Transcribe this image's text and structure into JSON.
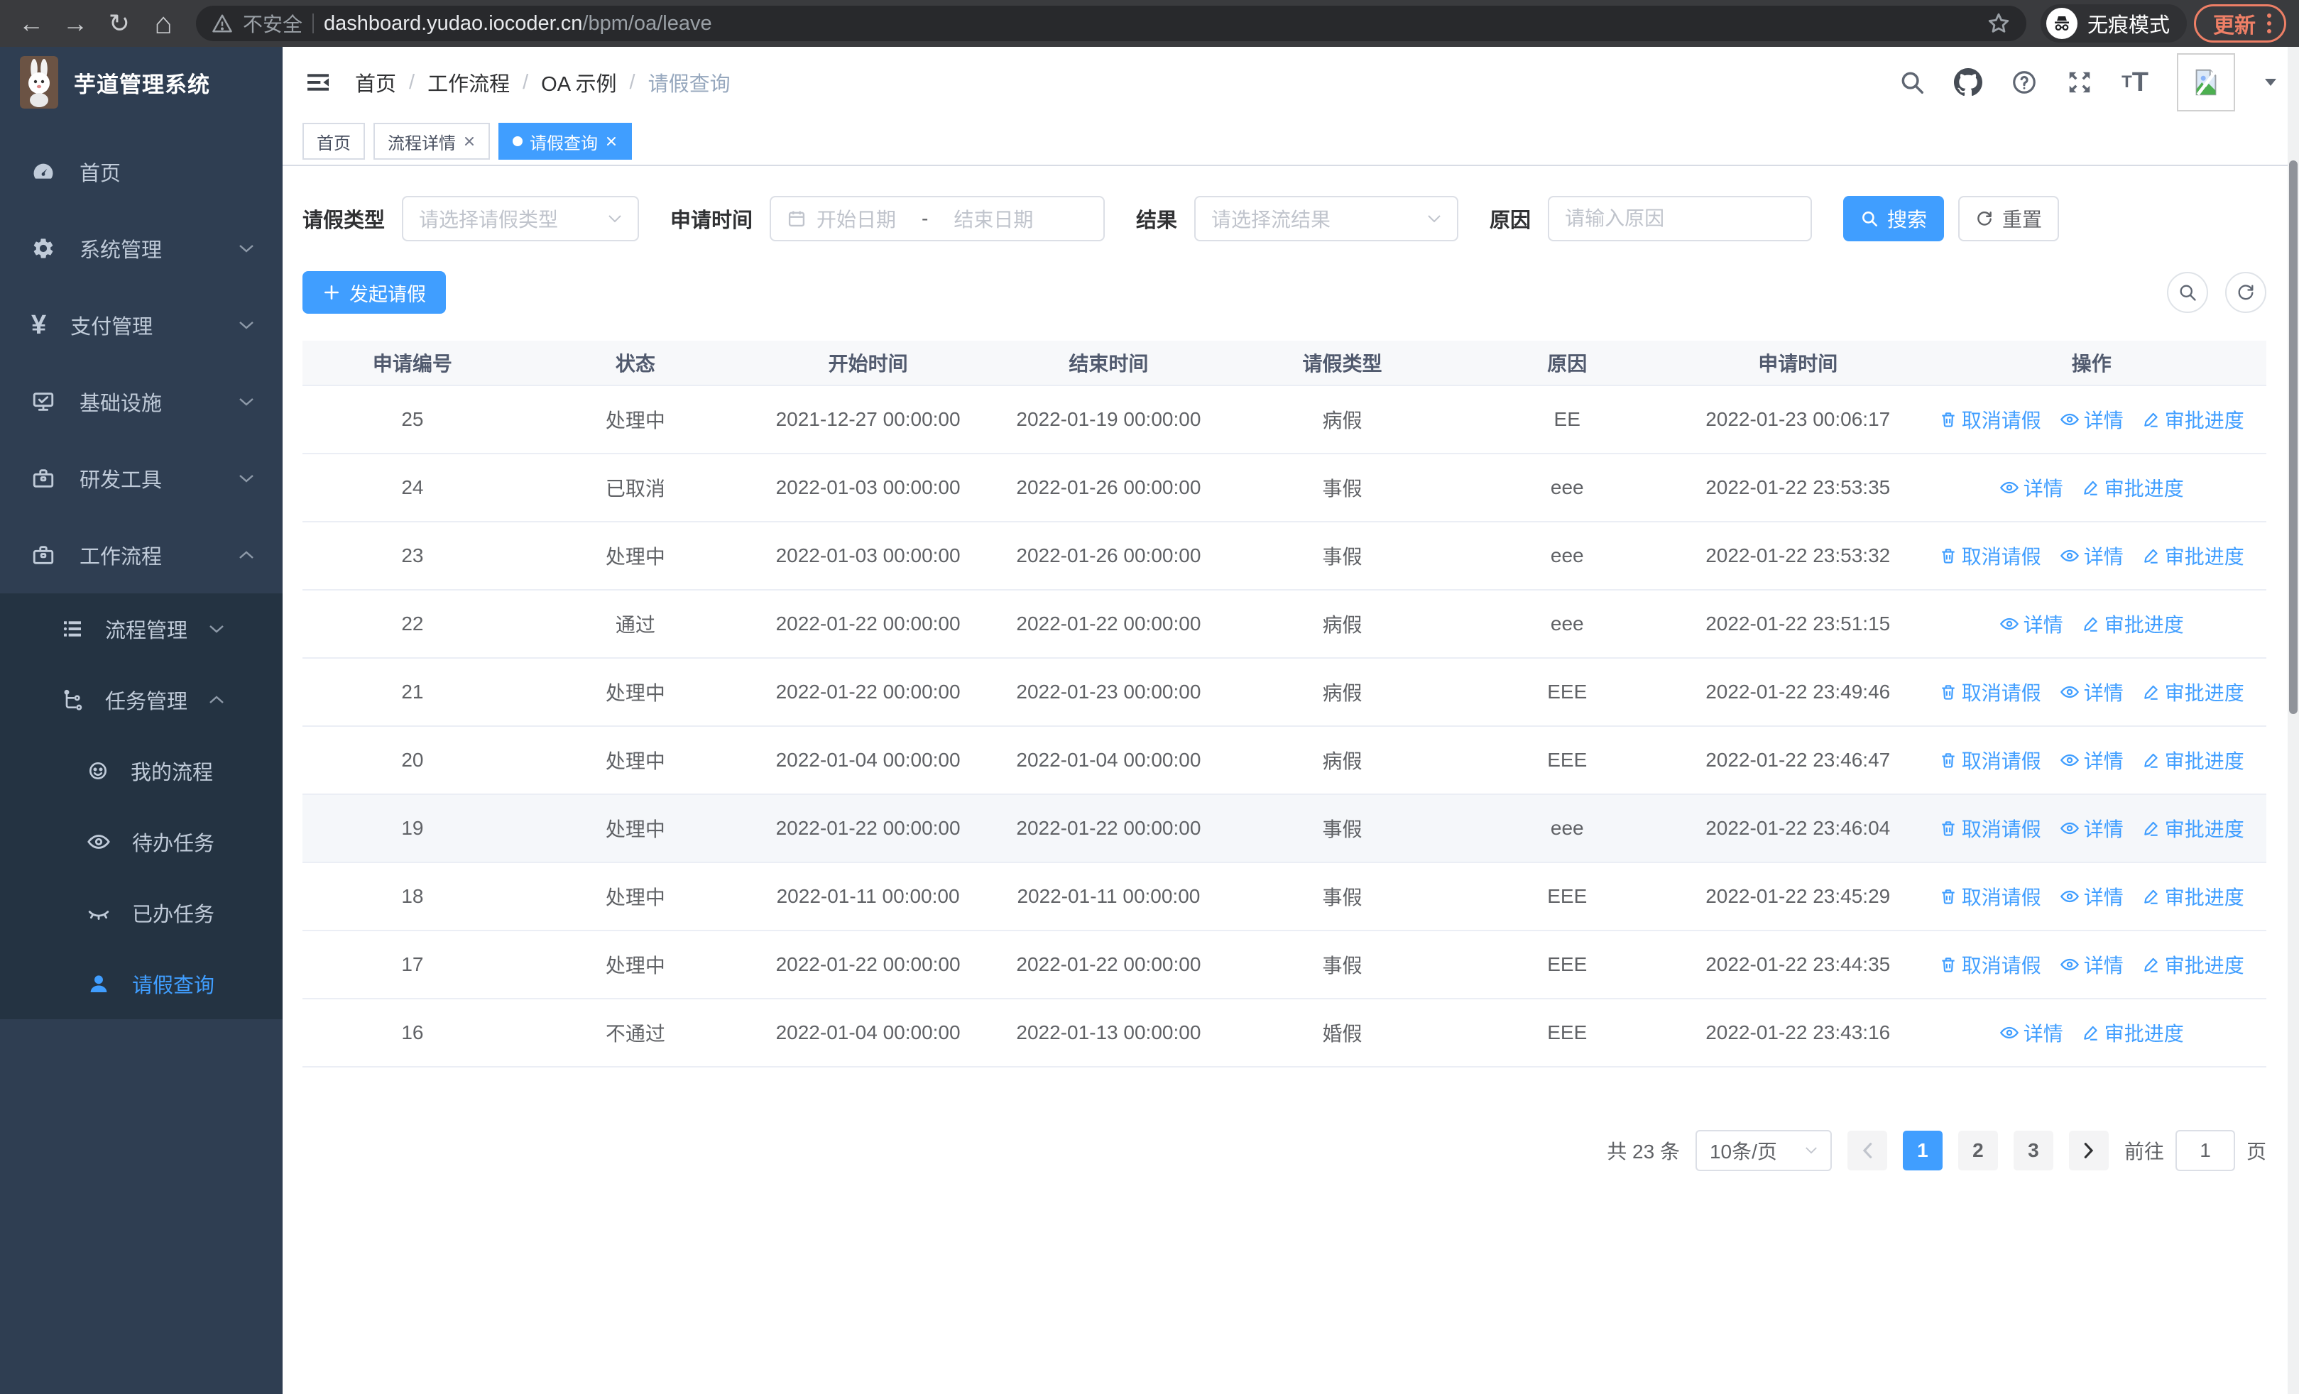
{
  "browser": {
    "security_warning": "不安全",
    "url_host": "dashboard.yudao.iocoder.cn",
    "url_path": "/bpm/oa/leave",
    "incognito_label": "无痕模式",
    "update_label": "更新"
  },
  "app": {
    "title": "芋道管理系统"
  },
  "breadcrumb": {
    "separator": "/",
    "items": [
      "首页",
      "工作流程",
      "OA 示例",
      "请假查询"
    ]
  },
  "tabs": {
    "items": [
      {
        "label": "首页"
      },
      {
        "label": "流程详情"
      },
      {
        "label": "请假查询"
      }
    ]
  },
  "sidebar": {
    "items": [
      {
        "label": "首页"
      },
      {
        "label": "系统管理"
      },
      {
        "label": "支付管理"
      },
      {
        "label": "基础设施"
      },
      {
        "label": "研发工具"
      },
      {
        "label": "工作流程"
      }
    ],
    "workflow_children": [
      {
        "label": "流程管理"
      },
      {
        "label": "任务管理"
      }
    ],
    "task_children": [
      {
        "label": "我的流程"
      },
      {
        "label": "待办任务"
      },
      {
        "label": "已办任务"
      },
      {
        "label": "请假查询"
      }
    ]
  },
  "filters": {
    "leave_type": {
      "label": "请假类型",
      "placeholder": "请选择请假类型"
    },
    "apply_time": {
      "label": "申请时间",
      "start_placeholder": "开始日期",
      "separator": "-",
      "end_placeholder": "结束日期"
    },
    "result": {
      "label": "结果",
      "placeholder": "请选择流结果"
    },
    "reason": {
      "label": "原因",
      "placeholder": "请输入原因"
    },
    "search_label": "搜索",
    "reset_label": "重置"
  },
  "toolbar": {
    "create_label": "发起请假"
  },
  "table": {
    "columns": [
      "申请编号",
      "状态",
      "开始时间",
      "结束时间",
      "请假类型",
      "原因",
      "申请时间",
      "操作"
    ],
    "action_labels": {
      "cancel": "取消请假",
      "detail": "详情",
      "progress": "审批进度"
    },
    "rows": [
      {
        "id": "25",
        "status": "处理中",
        "start": "2021-12-27 00:00:00",
        "end": "2022-01-19 00:00:00",
        "type": "病假",
        "reason": "EE",
        "applied": "2022-01-23 00:06:17",
        "actions": [
          "cancel",
          "detail",
          "progress"
        ],
        "hover": false
      },
      {
        "id": "24",
        "status": "已取消",
        "start": "2022-01-03 00:00:00",
        "end": "2022-01-26 00:00:00",
        "type": "事假",
        "reason": "eee",
        "applied": "2022-01-22 23:53:35",
        "actions": [
          "detail",
          "progress"
        ],
        "hover": false
      },
      {
        "id": "23",
        "status": "处理中",
        "start": "2022-01-03 00:00:00",
        "end": "2022-01-26 00:00:00",
        "type": "事假",
        "reason": "eee",
        "applied": "2022-01-22 23:53:32",
        "actions": [
          "cancel",
          "detail",
          "progress"
        ],
        "hover": false
      },
      {
        "id": "22",
        "status": "通过",
        "start": "2022-01-22 00:00:00",
        "end": "2022-01-22 00:00:00",
        "type": "病假",
        "reason": "eee",
        "applied": "2022-01-22 23:51:15",
        "actions": [
          "detail",
          "progress"
        ],
        "hover": false
      },
      {
        "id": "21",
        "status": "处理中",
        "start": "2022-01-22 00:00:00",
        "end": "2022-01-23 00:00:00",
        "type": "病假",
        "reason": "EEE",
        "applied": "2022-01-22 23:49:46",
        "actions": [
          "cancel",
          "detail",
          "progress"
        ],
        "hover": false
      },
      {
        "id": "20",
        "status": "处理中",
        "start": "2022-01-04 00:00:00",
        "end": "2022-01-04 00:00:00",
        "type": "病假",
        "reason": "EEE",
        "applied": "2022-01-22 23:46:47",
        "actions": [
          "cancel",
          "detail",
          "progress"
        ],
        "hover": false
      },
      {
        "id": "19",
        "status": "处理中",
        "start": "2022-01-22 00:00:00",
        "end": "2022-01-22 00:00:00",
        "type": "事假",
        "reason": "eee",
        "applied": "2022-01-22 23:46:04",
        "actions": [
          "cancel",
          "detail",
          "progress"
        ],
        "hover": true
      },
      {
        "id": "18",
        "status": "处理中",
        "start": "2022-01-11 00:00:00",
        "end": "2022-01-11 00:00:00",
        "type": "事假",
        "reason": "EEE",
        "applied": "2022-01-22 23:45:29",
        "actions": [
          "cancel",
          "detail",
          "progress"
        ],
        "hover": false
      },
      {
        "id": "17",
        "status": "处理中",
        "start": "2022-01-22 00:00:00",
        "end": "2022-01-22 00:00:00",
        "type": "事假",
        "reason": "EEE",
        "applied": "2022-01-22 23:44:35",
        "actions": [
          "cancel",
          "detail",
          "progress"
        ],
        "hover": false
      },
      {
        "id": "16",
        "status": "不通过",
        "start": "2022-01-04 00:00:00",
        "end": "2022-01-13 00:00:00",
        "type": "婚假",
        "reason": "EEE",
        "applied": "2022-01-22 23:43:16",
        "actions": [
          "detail",
          "progress"
        ],
        "hover": false
      }
    ]
  },
  "pagination": {
    "total_label": "共 23 条",
    "page_size_label": "10条/页",
    "pages": [
      "1",
      "2",
      "3"
    ],
    "goto_label": "前往",
    "goto_value": "1",
    "page_unit": "页"
  },
  "colors": {
    "accent": "#409EFF",
    "sidebar_bg": "#2f3e52",
    "update_accent": "#ee7f66"
  }
}
